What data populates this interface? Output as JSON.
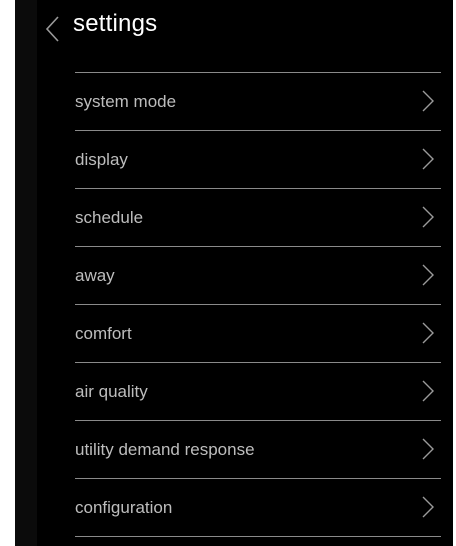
{
  "header": {
    "title": "settings",
    "back_icon": "chevron-left-icon"
  },
  "menu": {
    "items": [
      {
        "label": "system mode",
        "icon": "chevron-right-icon"
      },
      {
        "label": "display",
        "icon": "chevron-right-icon"
      },
      {
        "label": "schedule",
        "icon": "chevron-right-icon"
      },
      {
        "label": "away",
        "icon": "chevron-right-icon"
      },
      {
        "label": "comfort",
        "icon": "chevron-right-icon"
      },
      {
        "label": "air quality",
        "icon": "chevron-right-icon"
      },
      {
        "label": "utility demand response",
        "icon": "chevron-right-icon"
      },
      {
        "label": "configuration",
        "icon": "chevron-right-icon"
      }
    ]
  },
  "colors": {
    "background": "#000000",
    "title": "#ffffff",
    "label": "#bdbdbd",
    "divider": "#8a8a8a",
    "chevron": "#9a9a9a"
  }
}
